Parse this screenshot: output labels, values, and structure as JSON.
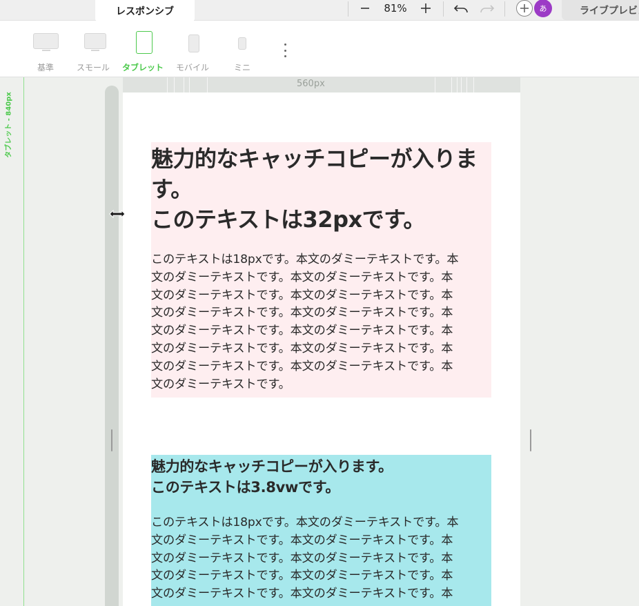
{
  "topbar": {
    "active_tab": "レスポンシブ",
    "zoom": "81%",
    "avatar_initial": "あ",
    "live_tab": "ライブプレビュー"
  },
  "devices": [
    {
      "label": "基準",
      "icon": "desktop-icon",
      "active": false
    },
    {
      "label": "スモール",
      "icon": "laptop-icon",
      "active": false
    },
    {
      "label": "タブレット",
      "icon": "tablet-icon",
      "active": true
    },
    {
      "label": "モバイル",
      "icon": "mobile-icon",
      "active": false
    },
    {
      "label": "ミニ",
      "icon": "mini-mobile-icon",
      "active": false
    }
  ],
  "canvas": {
    "breakpoint_label": "タブレット - 840px",
    "width_label": "560px"
  },
  "section1": {
    "headline_lines": [
      "魅力的なキャッチコピーが入りま",
      "す。",
      "このテキストは32pxです。"
    ],
    "body_lines": [
      "このテキストは18pxです。本文のダミーテキストです。本",
      "文のダミーテキストです。本文のダミーテキストです。本",
      "文のダミーテキストです。本文のダミーテキストです。本",
      "文のダミーテキストです。本文のダミーテキストです。本",
      "文のダミーテキストです。本文のダミーテキストです。本",
      "文のダミーテキストです。本文のダミーテキストです。本",
      "文のダミーテキストです。本文のダミーテキストです。本",
      "文のダミーテキストです。"
    ]
  },
  "section2": {
    "headline_lines": [
      "魅力的なキャッチコピーが入ります。",
      "このテキストは3.8vwです。"
    ],
    "body_lines": [
      "このテキストは18pxです。本文のダミーテキストです。本",
      "文のダミーテキストです。本文のダミーテキストです。本",
      "文のダミーテキストです。本文のダミーテキストです。本",
      "文のダミーテキストです。本文のダミーテキストです。本",
      "文のダミーテキストです。本文のダミーテキストです。本"
    ]
  },
  "colors": {
    "accent_green": "#4cc94c",
    "pink_section": "#feeef0",
    "cyan_section": "#a7e8ec",
    "avatar": "#9c3bc6"
  }
}
